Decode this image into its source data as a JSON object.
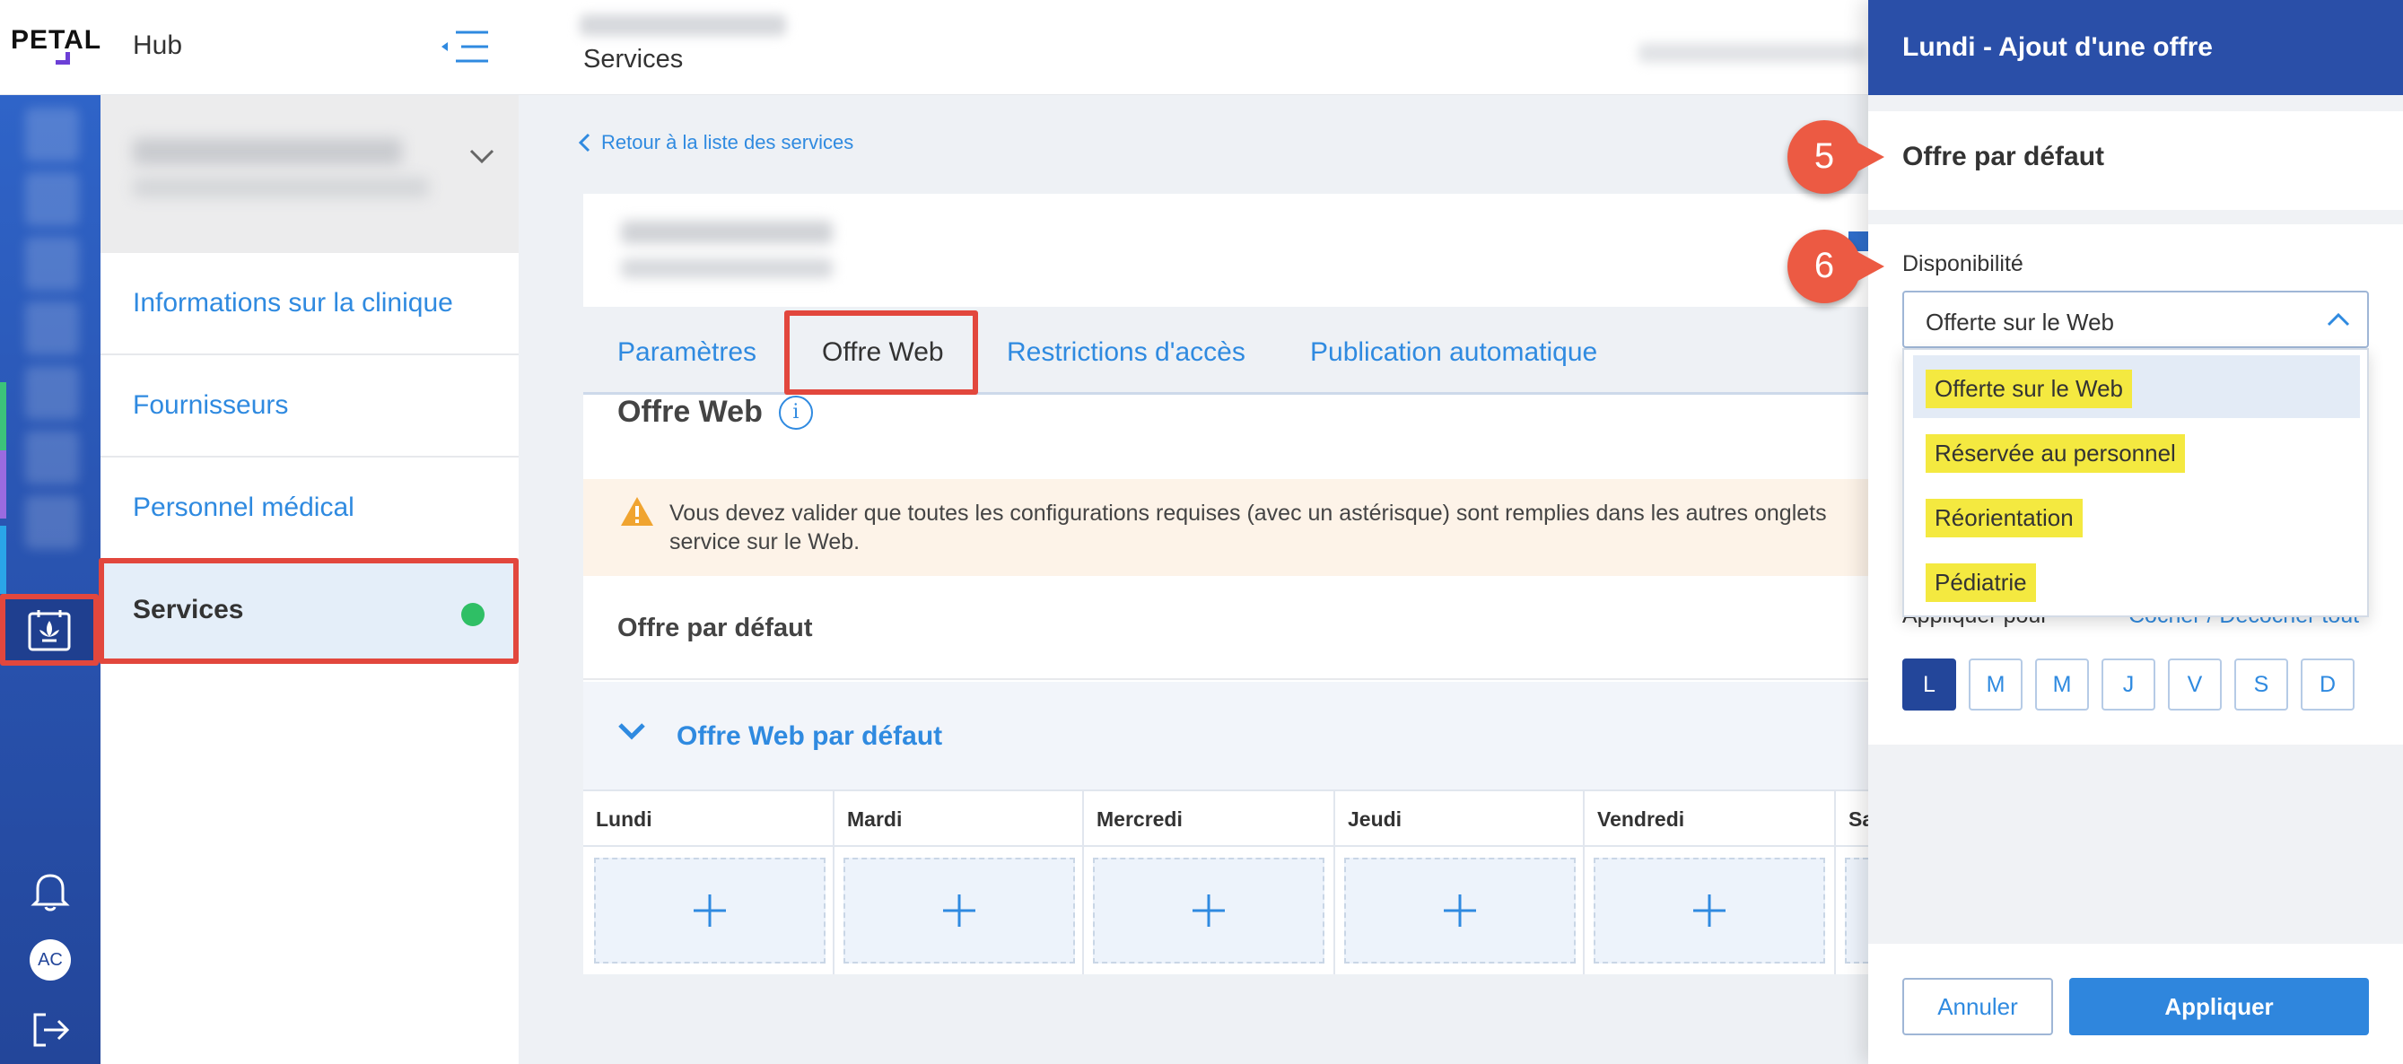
{
  "app": {
    "logo": "PETAL",
    "hub_label": "Hub",
    "page_title": "Services"
  },
  "sidebar": {
    "items": [
      {
        "label": "Informations sur la clinique"
      },
      {
        "label": "Fournisseurs"
      },
      {
        "label": "Personnel médical"
      },
      {
        "label": "Services"
      }
    ]
  },
  "rail": {
    "avatar_initials": "AC"
  },
  "main": {
    "back_link": "Retour à la liste des services",
    "tabs": [
      {
        "label": "Paramètres"
      },
      {
        "label": "Offre Web"
      },
      {
        "label": "Restrictions d'accès"
      },
      {
        "label": "Publication automatique"
      }
    ],
    "section_title": "Offre Web",
    "warning_text": "Vous devez valider que toutes les configurations requises (avec un astérisque) sont remplies dans les autres onglets service sur le Web.",
    "offre_par_defaut": "Offre par défaut",
    "accordion_label": "Offre Web par défaut",
    "days": [
      "Lundi",
      "Mardi",
      "Mercredi",
      "Jeudi",
      "Vendredi",
      "Sa"
    ]
  },
  "drawer": {
    "title": "Lundi - Ajout d'une offre",
    "section_title": "Offre par défaut",
    "dispo_label": "Disponibilité",
    "selected_value": "Offerte sur le Web",
    "options": [
      "Offerte sur le Web",
      "Réservée au personnel",
      "Réorientation",
      "Pédiatrie"
    ],
    "appliquer_label": "Appliquer pour",
    "cocher_label": "Cocher / Décocher tout",
    "day_buttons": [
      "L",
      "M",
      "M",
      "J",
      "V",
      "S",
      "D"
    ],
    "cancel": "Annuler",
    "apply": "Appliquer"
  },
  "annotations": {
    "callout_5": "5",
    "callout_6": "6"
  },
  "colors": {
    "accent": "#2f8ae0",
    "drawer_header": "#2a4fa8",
    "highlight": "#f4e940",
    "annotation": "#e2473d"
  }
}
